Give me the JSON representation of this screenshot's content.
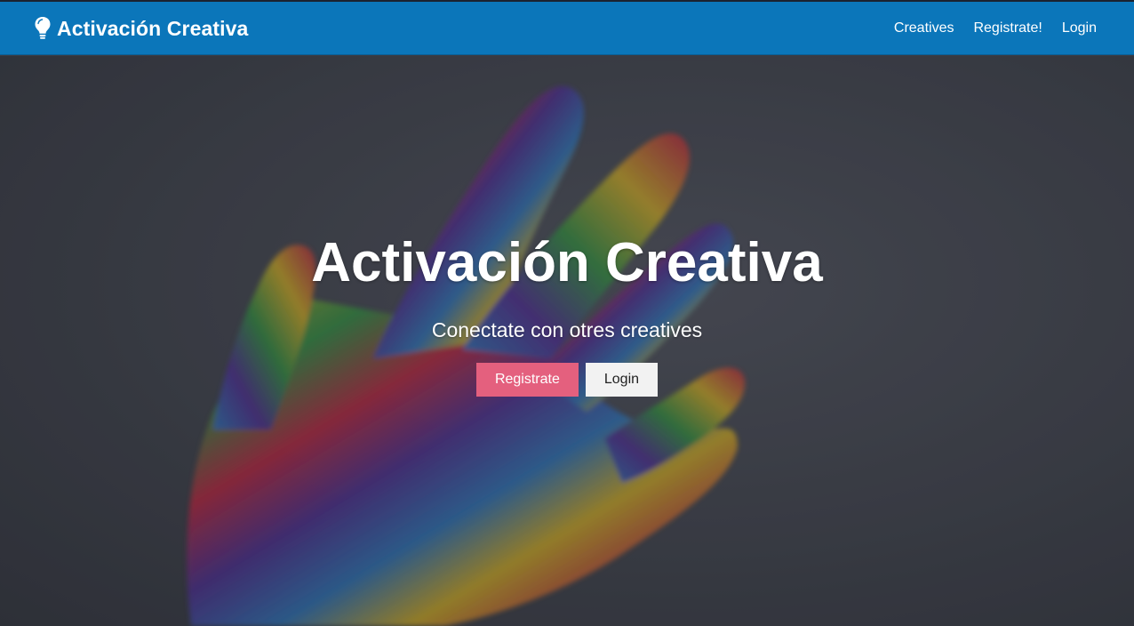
{
  "brand": {
    "name": "Activación Creativa",
    "icon": "lightbulb-icon",
    "color": "#0b76ba"
  },
  "nav": {
    "items": [
      "Creatives",
      "Registrate!",
      "Login"
    ]
  },
  "hero": {
    "title": "Activación Creativa",
    "subtitle": "Conectate con otres creatives",
    "primary_button": "Registrate",
    "secondary_button": "Login",
    "primary_color": "#e4607e",
    "background_image": "rainbow-painted-hand"
  }
}
